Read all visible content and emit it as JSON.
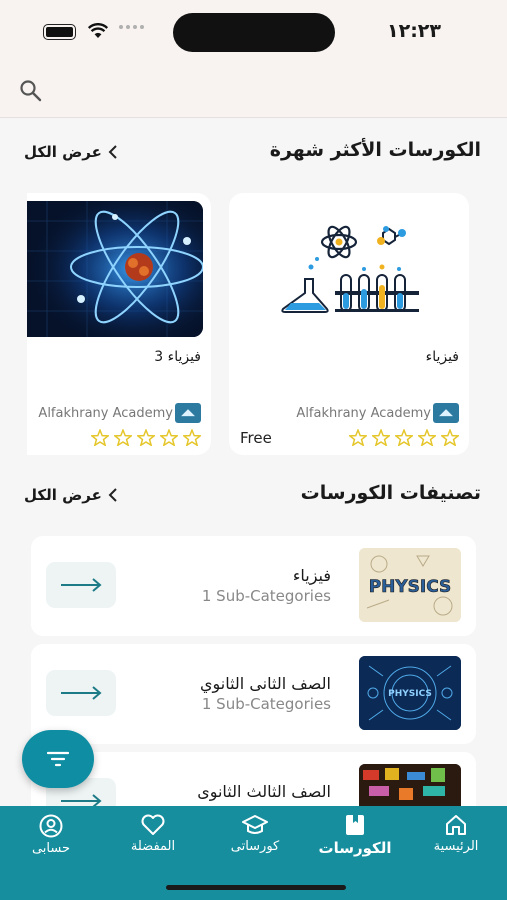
{
  "status_bar": {
    "time": "١٢:٢٣"
  },
  "popular": {
    "title": "الكورسات الأكثر شهرة",
    "view_all": "عرض الكل",
    "courses": [
      {
        "title": "فيزياء",
        "provider": "Alfakhrany Academy",
        "price": "Free",
        "rating": 0
      },
      {
        "title": "فيزياء 3",
        "provider": "Alfakhrany Academy",
        "rating": 0
      }
    ]
  },
  "categories": {
    "title": "تصنيفات الكورسات",
    "view_all": "عرض الكل",
    "items": [
      {
        "name": "فيزياء",
        "sub": "1 Sub-Categories",
        "thumb_text": "PHYSICS"
      },
      {
        "name": "الصف الثانى الثانوي",
        "sub": "1 Sub-Categories",
        "thumb_text": "PHYSICS"
      },
      {
        "name": "الصف الثالث الثانوى"
      }
    ]
  },
  "bottom_nav": [
    {
      "label": "الرئيسية",
      "icon": "home-icon"
    },
    {
      "label": "الكورسات",
      "icon": "book-icon",
      "active": true
    },
    {
      "label": "كورساتى",
      "icon": "graduation-cap-icon"
    },
    {
      "label": "المفضلة",
      "icon": "heart-icon"
    },
    {
      "label": "حسابى",
      "icon": "account-icon"
    }
  ],
  "colors": {
    "accent": "#168e9e",
    "star": "#e5c62a",
    "fab": "#0f8ea3"
  }
}
